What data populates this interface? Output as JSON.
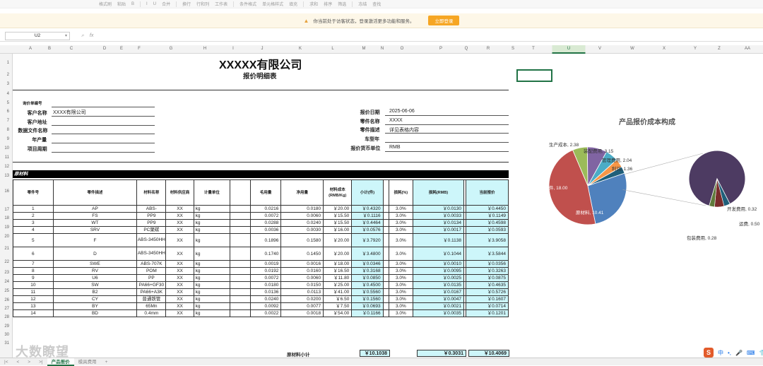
{
  "toolbar": {
    "items": [
      "格式刷",
      "粘贴",
      "B",
      "I",
      "U",
      "合并",
      "换行",
      "行和列",
      "工作表",
      "条件格式",
      "单元格样式",
      "填充",
      "求和",
      "排序",
      "筛选",
      "冻结",
      "查找"
    ]
  },
  "notice": {
    "text": "你当前处于访客状态，登录激活更多功能和服务。",
    "button": "立即登录"
  },
  "formula_bar": {
    "cell_ref": "U2",
    "fx": "fx",
    "value": ""
  },
  "columns": [
    "A",
    "B",
    "C",
    "D",
    "E",
    "F",
    "G",
    "H",
    "I",
    "J",
    "K",
    "L",
    "M",
    "N",
    "O",
    "P",
    "Q",
    "R",
    "S",
    "T",
    "U",
    "V",
    "W",
    "X",
    "Y",
    "Z",
    "AA",
    "AB"
  ],
  "rows": [
    "1",
    "2",
    "3",
    "4",
    "5",
    "6",
    "7",
    "8",
    "9",
    "10",
    "11",
    "12",
    "13",
    "16",
    "17",
    "18",
    "19",
    "20",
    "21",
    "22",
    "23",
    "24",
    "25",
    "26",
    "27",
    "28",
    "29",
    "30",
    "31"
  ],
  "doc": {
    "company": "XXXXX有限公司",
    "subtitle": "报价明细表",
    "left_labels": [
      "询价单编号",
      "客户名称",
      "客户地址",
      "数据文件名称",
      "年产量",
      "项目周期"
    ],
    "customer_name": "XXXX有限公司",
    "right_labels": [
      "报价日期",
      "零件名称",
      "零件描述",
      "车型年",
      "报价货币单位"
    ],
    "right_values": [
      "2025-06-06",
      "XXXX",
      "详见表格内容",
      "",
      "RMB"
    ],
    "section": "原材料"
  },
  "table": {
    "headers": [
      "零件号",
      "零件描述",
      "材料名称",
      "材料供应商",
      "计量单位",
      "",
      "毛用量",
      "净用量",
      "材料成本\n(RMB/Kg)",
      "小计(件)",
      "",
      "损耗(%)",
      "损耗(RMB)",
      "",
      "当前报价"
    ],
    "rows": [
      [
        "1",
        "AP",
        "ABS-",
        "XX",
        "kg",
        "",
        "0.0216",
        "0.0180",
        "￥20.00",
        "￥0.4320",
        "",
        "3.0%",
        "￥0.0130",
        "",
        "￥0.4450"
      ],
      [
        "2",
        "FS",
        "PP9",
        "XX",
        "kg",
        "",
        "0.0072",
        "0.0060",
        "￥15.50",
        "￥0.1116",
        "",
        "3.0%",
        "￥0.0033",
        "",
        "￥0.1149"
      ],
      [
        "3",
        "WT",
        "PP9",
        "XX",
        "kg",
        "",
        "0.0288",
        "0.0240",
        "￥15.50",
        "￥0.4464",
        "",
        "3.0%",
        "￥0.0134",
        "",
        "￥0.4598"
      ],
      [
        "4",
        "SRV",
        "PC聚碳",
        "XX",
        "kg",
        "",
        "0.0036",
        "0.0030",
        "￥16.00",
        "￥0.0576",
        "",
        "3.0%",
        "￥0.0017",
        "",
        "￥0.0593"
      ],
      [
        "5",
        "F",
        "ABS-3450HH",
        "XX",
        "kg",
        "",
        "0.1896",
        "0.1580",
        "￥20.00",
        "￥3.7920",
        "",
        "3.0%",
        "￥0.1138",
        "",
        "￥3.9058"
      ],
      [
        "6",
        "D",
        "ABS-3450HH",
        "XX",
        "kg",
        "",
        "0.1740",
        "0.1450",
        "￥20.00",
        "￥3.4800",
        "",
        "3.0%",
        "￥0.1044",
        "",
        "￥3.5844"
      ],
      [
        "7",
        "SWE",
        "ABS-707K",
        "XX",
        "kg",
        "",
        "0.0019",
        "0.0016",
        "￥18.00",
        "￥0.0346",
        "",
        "3.0%",
        "￥0.0010",
        "",
        "￥0.0356"
      ],
      [
        "8",
        "RV",
        "POM",
        "XX",
        "kg",
        "",
        "0.0192",
        "0.0160",
        "￥16.50",
        "￥0.3168",
        "",
        "3.0%",
        "￥0.0095",
        "",
        "￥0.3263"
      ],
      [
        "9",
        "U6",
        "PP",
        "XX",
        "kg",
        "",
        "0.0072",
        "0.0060",
        "￥11.80",
        "￥0.0850",
        "",
        "3.0%",
        "￥0.0025",
        "",
        "￥0.0875"
      ],
      [
        "10",
        "SW",
        "PA66+GF30",
        "XX",
        "kg",
        "",
        "0.0180",
        "0.0150",
        "￥25.00",
        "￥0.4500",
        "",
        "3.0%",
        "￥0.0135",
        "",
        "￥0.4635"
      ],
      [
        "11",
        "B2",
        "PA66+A3K",
        "XX",
        "kg",
        "",
        "0.0136",
        "0.0113",
        "￥41.00",
        "￥0.5560",
        "",
        "3.0%",
        "￥0.0167",
        "",
        "￥0.5726"
      ],
      [
        "12",
        "CY",
        "普通铁管",
        "XX",
        "kg",
        "",
        "0.0240",
        "0.0200",
        "￥6.50",
        "￥0.1560",
        "",
        "3.0%",
        "￥0.0047",
        "",
        "￥0.1607"
      ],
      [
        "13",
        "BY",
        "65Mn",
        "XX",
        "kg",
        "",
        "0.0092",
        "0.0077",
        "￥7.50",
        "￥0.0693",
        "",
        "3.0%",
        "￥0.0021",
        "",
        "￥0.0714"
      ],
      [
        "14",
        "BD",
        "0.4mm",
        "XX",
        "kg",
        "",
        "0.0022",
        "0.0018",
        "￥54.00",
        "￥0.1166",
        "",
        "3.0%",
        "￥0.0035",
        "",
        "￥0.1201"
      ]
    ],
    "subtotal_label": "原材料小计",
    "subtotal_values": [
      "￥10.1038",
      "￥0.3031",
      "￥10.4069"
    ]
  },
  "chart_data": {
    "type": "pie",
    "title": "产品报价成本构成",
    "slices": [
      {
        "name": "外购件",
        "value": 18.0
      },
      {
        "name": "原材料",
        "value": 10.41
      },
      {
        "name": "生产成本",
        "value": 2.38
      },
      {
        "name": "装配费用",
        "value": 3.15
      },
      {
        "name": "管理费用",
        "value": 2.04
      },
      {
        "name": "利润",
        "value": 1.36
      }
    ],
    "secondary_slices": [
      {
        "name": "开发费用",
        "value": 0.32
      },
      {
        "name": "运费",
        "value": 0.5
      },
      {
        "name": "包装费用",
        "value": 0.28
      }
    ],
    "labels": [
      "外购件, 18.00",
      "原材料, 10.41",
      "生产成本, 2.38",
      "装配费用, 3.15",
      "管理费用, 2.04",
      "利润, 1.36",
      "开发费用, 0.32",
      "运费, 0.50",
      "包装费用, 0.28"
    ],
    "colors": [
      "#c0504d",
      "#4f81bd",
      "#9bbb59",
      "#8064a2",
      "#4bacc6",
      "#f79646",
      "#1f5f7a",
      "#4d3b62",
      "#7a2c2c",
      "#5e7a3a"
    ]
  },
  "sheet_tabs": {
    "tabs": [
      "产品报价",
      "模具费用"
    ],
    "active": "产品报价",
    "add": "+"
  },
  "watermark": "大数瞭望",
  "tray": {
    "items": [
      "S",
      "中",
      "•,",
      "🎤",
      "⌨",
      "👕"
    ]
  }
}
